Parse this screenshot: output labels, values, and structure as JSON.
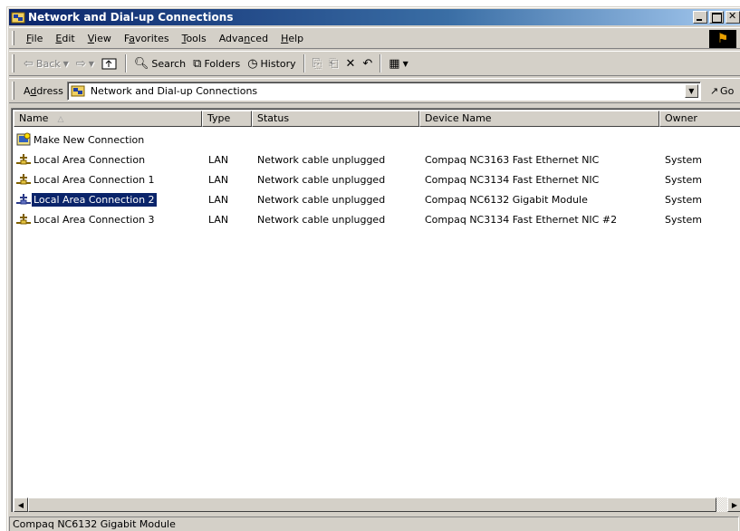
{
  "window": {
    "title": "Network and Dial-up Connections"
  },
  "menu": [
    {
      "pre": "",
      "key": "F",
      "post": "ile"
    },
    {
      "pre": "",
      "key": "E",
      "post": "dit"
    },
    {
      "pre": "",
      "key": "V",
      "post": "iew"
    },
    {
      "pre": "F",
      "key": "a",
      "post": "vorites"
    },
    {
      "pre": "",
      "key": "T",
      "post": "ools"
    },
    {
      "pre": "Adva",
      "key": "n",
      "post": "ced"
    },
    {
      "pre": "",
      "key": "H",
      "post": "elp"
    }
  ],
  "toolbar": {
    "back": "Back",
    "search": "Search",
    "folders": "Folders",
    "history": "History"
  },
  "address": {
    "label_pre": "A",
    "label_key": "d",
    "label_post": "dress",
    "value": "Network and Dial-up Connections",
    "go": "Go"
  },
  "columns": {
    "name": "Name",
    "type": "Type",
    "status": "Status",
    "device": "Device Name",
    "owner": "Owner"
  },
  "items": [
    {
      "name": "Make New Connection",
      "type": "",
      "status": "",
      "device": "",
      "owner": "",
      "icon": "make-new-connection-icon"
    },
    {
      "name": "Local Area Connection",
      "type": "LAN",
      "status": "Network cable unplugged",
      "device": "Compaq NC3163 Fast Ethernet NIC",
      "owner": "System",
      "icon": "lan-connection-icon"
    },
    {
      "name": "Local Area Connection 1",
      "type": "LAN",
      "status": "Network cable unplugged",
      "device": "Compaq NC3134 Fast Ethernet NIC",
      "owner": "System",
      "icon": "lan-connection-icon"
    },
    {
      "name": "Local Area Connection 2",
      "type": "LAN",
      "status": "Network cable unplugged",
      "device": "Compaq NC6132 Gigabit Module",
      "owner": "System",
      "icon": "lan-connection-icon"
    },
    {
      "name": "Local Area Connection 3",
      "type": "LAN",
      "status": "Network cable unplugged",
      "device": "Compaq NC3134 Fast Ethernet NIC #2",
      "owner": "System",
      "icon": "lan-connection-icon"
    }
  ],
  "status_bar": {
    "text": "Compaq NC6132 Gigabit Module"
  },
  "colors": {
    "title_start": "#0a246a",
    "title_end": "#a6caf0",
    "selection": "#0a246a",
    "face": "#d4d0c8"
  }
}
